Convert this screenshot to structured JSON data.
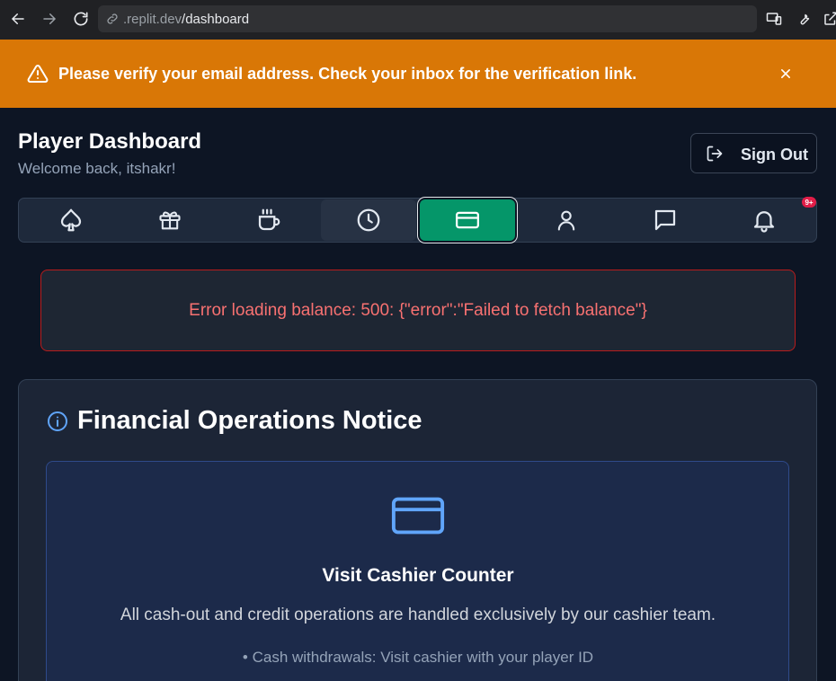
{
  "browser": {
    "url_host": ".replit.dev",
    "url_path": "/dashboard"
  },
  "banner": {
    "message": "Please verify your email address. Check your inbox for the verification link."
  },
  "header": {
    "title": "Player Dashboard",
    "subtitle": "Welcome back, itshakr!",
    "sign_out_label": "Sign Out"
  },
  "tabs": [
    {
      "icon": "spade-icon",
      "name": "games"
    },
    {
      "icon": "gift-icon",
      "name": "rewards"
    },
    {
      "icon": "coffee-icon",
      "name": "lounge"
    },
    {
      "icon": "clock-icon",
      "name": "history"
    },
    {
      "icon": "credit-card-icon",
      "name": "cashier",
      "active": true
    },
    {
      "icon": "user-icon",
      "name": "profile"
    },
    {
      "icon": "message-icon",
      "name": "messages"
    },
    {
      "icon": "bell-icon",
      "name": "notifications"
    }
  ],
  "notifications_badge": "9+",
  "error": {
    "message": "Error loading balance: 500: {\"error\":\"Failed to fetch balance\"}"
  },
  "notice": {
    "title": "Financial Operations Notice",
    "card_title": "Visit Cashier Counter",
    "card_description": "All cash-out and credit operations are handled exclusively by our cashier team.",
    "bullets": [
      "• Cash withdrawals: Visit cashier with your player ID"
    ]
  },
  "colors": {
    "banner": "#d97706",
    "active_tab": "#059669",
    "error_text": "#f87171",
    "accent_blue": "#60a5fa"
  }
}
